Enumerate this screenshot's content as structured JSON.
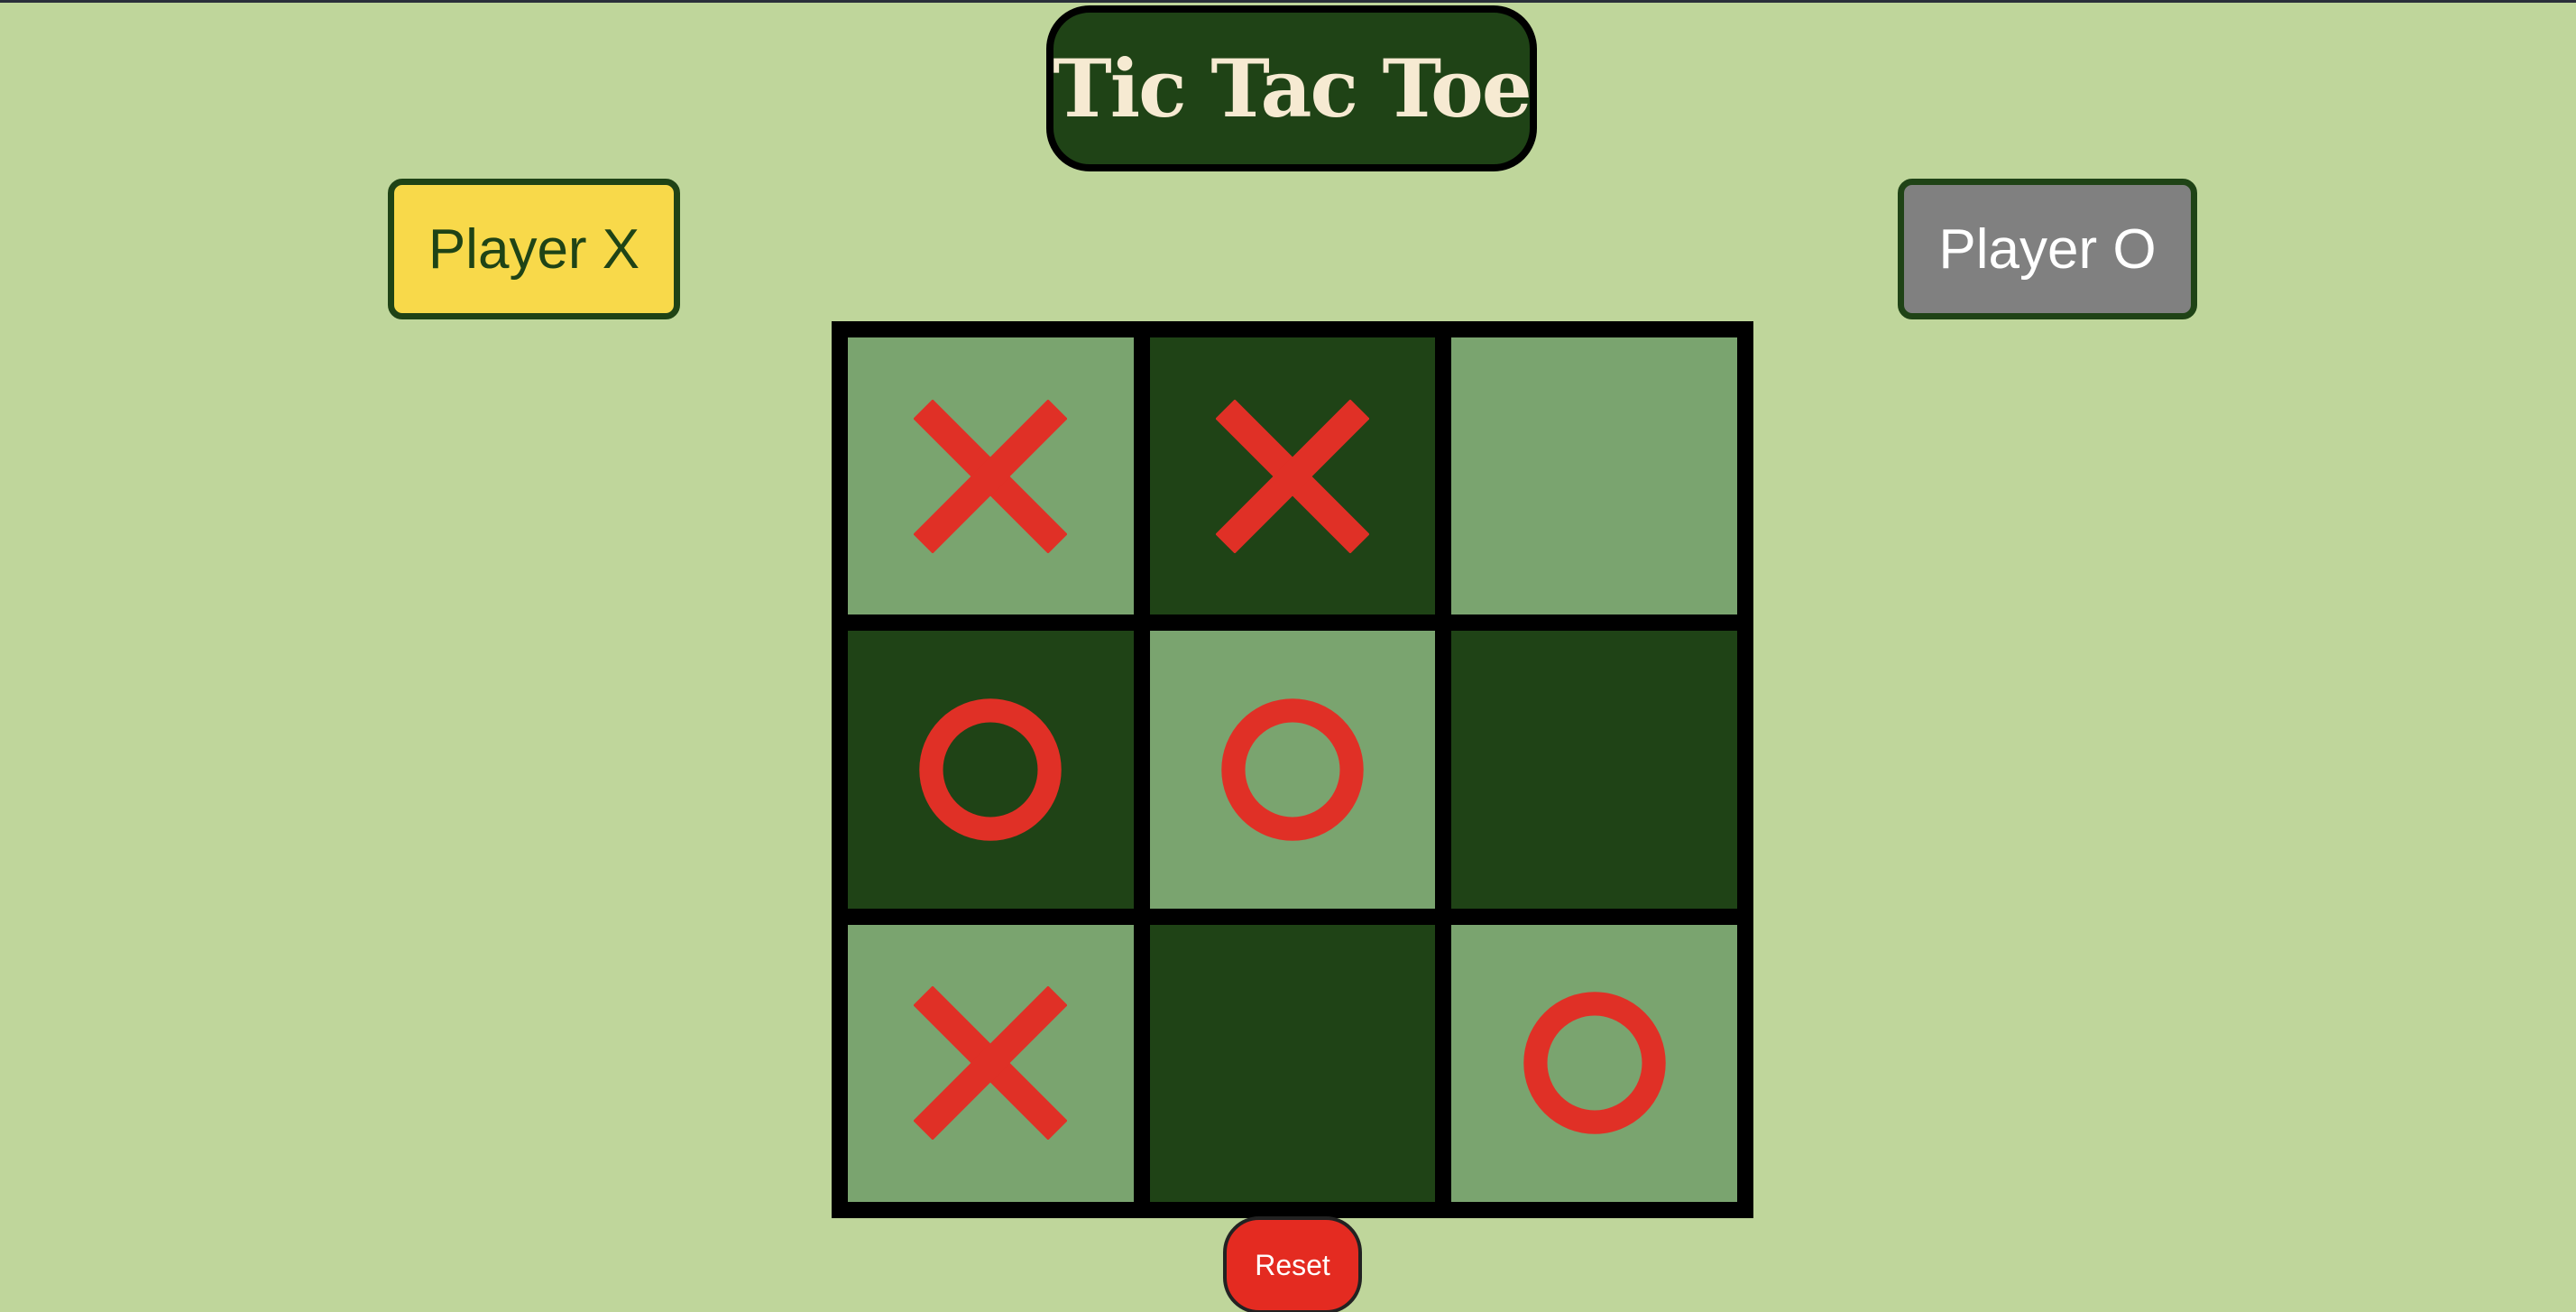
{
  "title": "Tic Tac Toe",
  "players": {
    "x_label": "Player X",
    "o_label": "Player O"
  },
  "reset_label": "Reset",
  "board": [
    {
      "mark": "X",
      "shade": "light"
    },
    {
      "mark": "X",
      "shade": "dark"
    },
    {
      "mark": "",
      "shade": "light"
    },
    {
      "mark": "O",
      "shade": "dark"
    },
    {
      "mark": "O",
      "shade": "light"
    },
    {
      "mark": "",
      "shade": "dark"
    },
    {
      "mark": "X",
      "shade": "light"
    },
    {
      "mark": "",
      "shade": "dark"
    },
    {
      "mark": "O",
      "shade": "light"
    }
  ],
  "colors": {
    "background": "#bfd69b",
    "dark_green": "#1f4316",
    "light_green": "#7aa46f",
    "mark_red": "#e03026",
    "active_player": "#f8d94a",
    "inactive_player": "#808080",
    "title_text": "#f6ead2"
  },
  "icons": {
    "x_mark": "x-mark-icon",
    "o_mark": "o-mark-icon"
  }
}
